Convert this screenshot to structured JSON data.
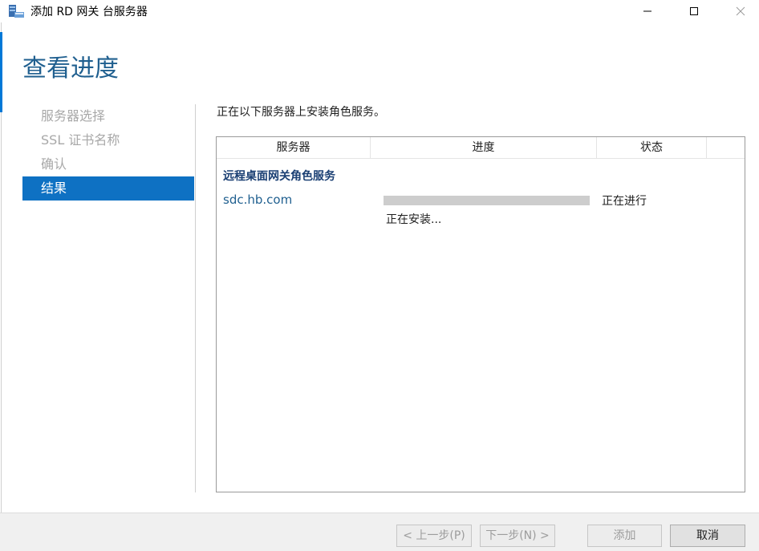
{
  "window": {
    "title": "添加 RD 网关 台服务器",
    "icon": "server-manager-icon",
    "controls": [
      "minimize-icon",
      "maximize-icon",
      "close-icon"
    ]
  },
  "page": {
    "title": "查看进度"
  },
  "nav": {
    "items": [
      {
        "label": "服务器选择",
        "active": false
      },
      {
        "label": "SSL 证书名称",
        "active": false
      },
      {
        "label": "确认",
        "active": false
      },
      {
        "label": "结果",
        "active": true
      }
    ]
  },
  "main": {
    "intro": "正在以下服务器上安装角色服务。",
    "columns": [
      "服务器",
      "进度",
      "状态"
    ],
    "group_title": "远程桌面网关角色服务",
    "rows": [
      {
        "server": "sdc.hb.com",
        "progress_fraction": 1.0,
        "status": "正在进行",
        "detail": "正在安装..."
      }
    ]
  },
  "footer": {
    "prev_label": "< 上一步(P)",
    "next_label": "下一步(N) >",
    "add_label": "添加",
    "cancel_label": "取消"
  },
  "colors": {
    "accent": "#0e71c3",
    "title": "#1f5f8f",
    "group_title": "#1a3f73",
    "progress": "#cdcdcd"
  }
}
